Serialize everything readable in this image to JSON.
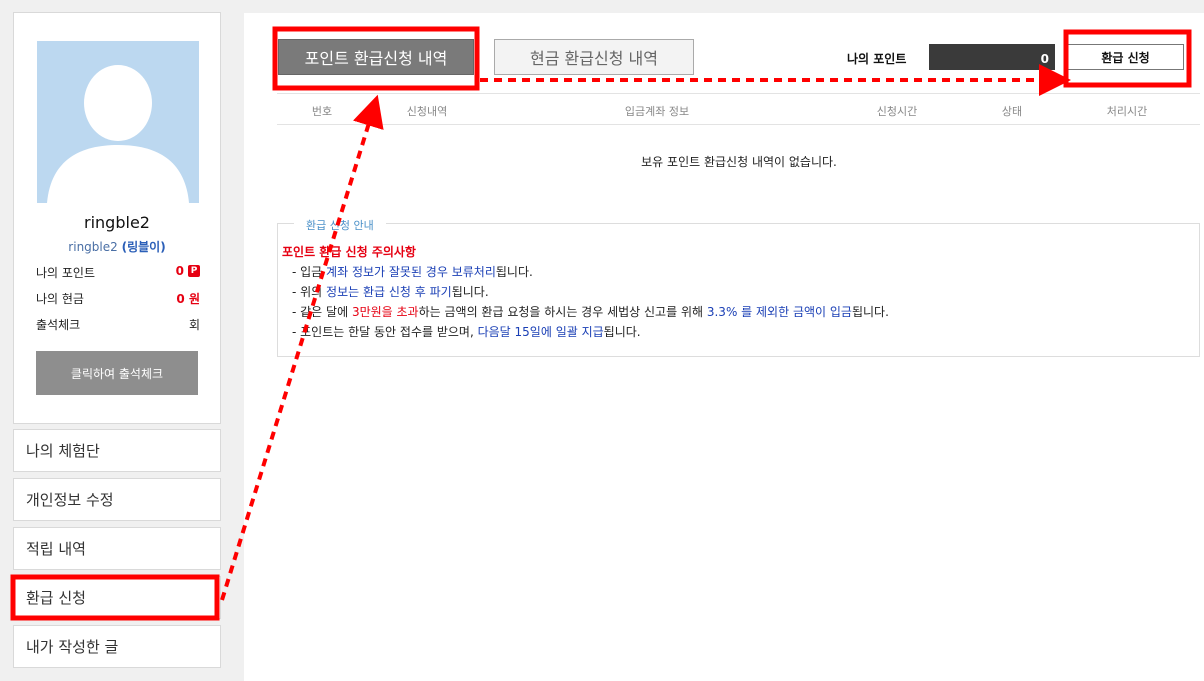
{
  "profile": {
    "username": "ringble2",
    "id_text": "ringble2",
    "nickname": "(링블이)",
    "stats": [
      {
        "label": "나의 포인트",
        "value": "0",
        "badge": "P"
      },
      {
        "label": "나의 현금",
        "value": "0 원"
      },
      {
        "label": "출석체크",
        "value": "회"
      }
    ],
    "attendance_button": "클릭하여 출석체크"
  },
  "sidebar_menu": [
    "나의 체험단",
    "개인정보 수정",
    "적립 내역",
    "환급 신청",
    "내가 작성한 글"
  ],
  "tabs": {
    "active": "포인트 환급신청 내역",
    "inactive": "현금 환급신청 내역"
  },
  "my_point": {
    "label": "나의 포인트",
    "value": "0"
  },
  "refund_button": "환급 신청",
  "table": {
    "headers": [
      "번호",
      "신청내역",
      "입금계좌 정보",
      "신청시간",
      "상태",
      "처리시간"
    ],
    "empty_message": "보유 포인트 환급신청 내역이 없습니다."
  },
  "guide": {
    "legend": "환급 신청 안내",
    "title": "포인트 환급 신청 주의사항",
    "line1": {
      "p1": "- 입금 ",
      "b1": "계좌 정보가 잘못된 경우 보류처리",
      "p2": "됩니다."
    },
    "line2": {
      "p1": "- 위의 ",
      "b1": "정보는 환급 신청 후 파기",
      "p2": "됩니다."
    },
    "line3": {
      "p1": "- 같은 달에 ",
      "r1": "3만원을 초과",
      "p2": "하는 금액의 환급 요청을 하시는 경우 세법상 신고를 위해 ",
      "b1": "3.3% 를 제외한 금액이 입금",
      "p3": "됩니다."
    },
    "line4": {
      "p1": "- 포인트는 한달 동안 접수를 받으며, ",
      "b1": "다음달 15일에 일괄 지급",
      "p2": "됩니다."
    }
  },
  "colors": {
    "highlight": "#ff0000",
    "accent_red": "#e60012",
    "link_blue": "#1a3fb5"
  }
}
